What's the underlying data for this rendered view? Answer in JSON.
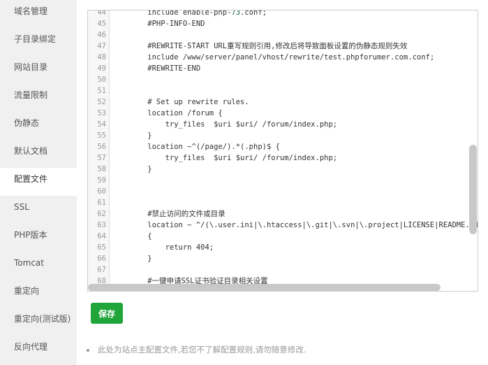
{
  "sidebar": {
    "items": [
      {
        "label": "域名管理"
      },
      {
        "label": "子目录绑定"
      },
      {
        "label": "网站目录"
      },
      {
        "label": "流量限制"
      },
      {
        "label": "伪静态"
      },
      {
        "label": "默认文档"
      },
      {
        "label": "配置文件",
        "active": true
      },
      {
        "label": "SSL"
      },
      {
        "label": "PHP版本"
      },
      {
        "label": "Tomcat"
      },
      {
        "label": "重定向"
      },
      {
        "label": "重定向(测试版)"
      },
      {
        "label": "反向代理"
      }
    ]
  },
  "editor": {
    "lines": [
      {
        "n": "44",
        "t": "    include enable-php-73.conf;"
      },
      {
        "n": "45",
        "t": "    #PHP-INFO-END"
      },
      {
        "n": "46",
        "t": ""
      },
      {
        "n": "47",
        "t": "    #REWRITE-START URL重写规则引用,修改后将导致面板设置的伪静态规则失效"
      },
      {
        "n": "48",
        "t": "    include /www/server/panel/vhost/rewrite/test.phpforumer.com.conf;"
      },
      {
        "n": "49",
        "t": "    #REWRITE-END"
      },
      {
        "n": "50",
        "t": ""
      },
      {
        "n": "51",
        "t": ""
      },
      {
        "n": "52",
        "t": "    # Set up rewrite rules."
      },
      {
        "n": "53",
        "t": "    location /forum {"
      },
      {
        "n": "54",
        "t": "        try_files  $uri $uri/ /forum/index.php;"
      },
      {
        "n": "55",
        "t": "    }"
      },
      {
        "n": "56",
        "t": "    location ~^(/page/).*(.php)$ {"
      },
      {
        "n": "57",
        "t": "        try_files  $uri $uri/ /forum/index.php;"
      },
      {
        "n": "58",
        "t": "    }"
      },
      {
        "n": "59",
        "t": ""
      },
      {
        "n": "60",
        "t": ""
      },
      {
        "n": "61",
        "t": ""
      },
      {
        "n": "62",
        "t": "    #禁止访问的文件或目录"
      },
      {
        "n": "63",
        "t": "    location ~ ^/(\\.user.ini|\\.htaccess|\\.git|\\.svn|\\.project|LICENSE|README.md)"
      },
      {
        "n": "64",
        "t": "    {"
      },
      {
        "n": "65",
        "t": "        return 404;"
      },
      {
        "n": "66",
        "t": "    }"
      },
      {
        "n": "67",
        "t": ""
      },
      {
        "n": "68",
        "t": "    #一键申请SSL证书验证目录相关设置"
      }
    ]
  },
  "save_label": "保存",
  "note": "此处为站点主配置文件,若您不了解配置规则,请勿随意修改.",
  "colors": {
    "accent": "#20a53a",
    "number": "#116644"
  }
}
